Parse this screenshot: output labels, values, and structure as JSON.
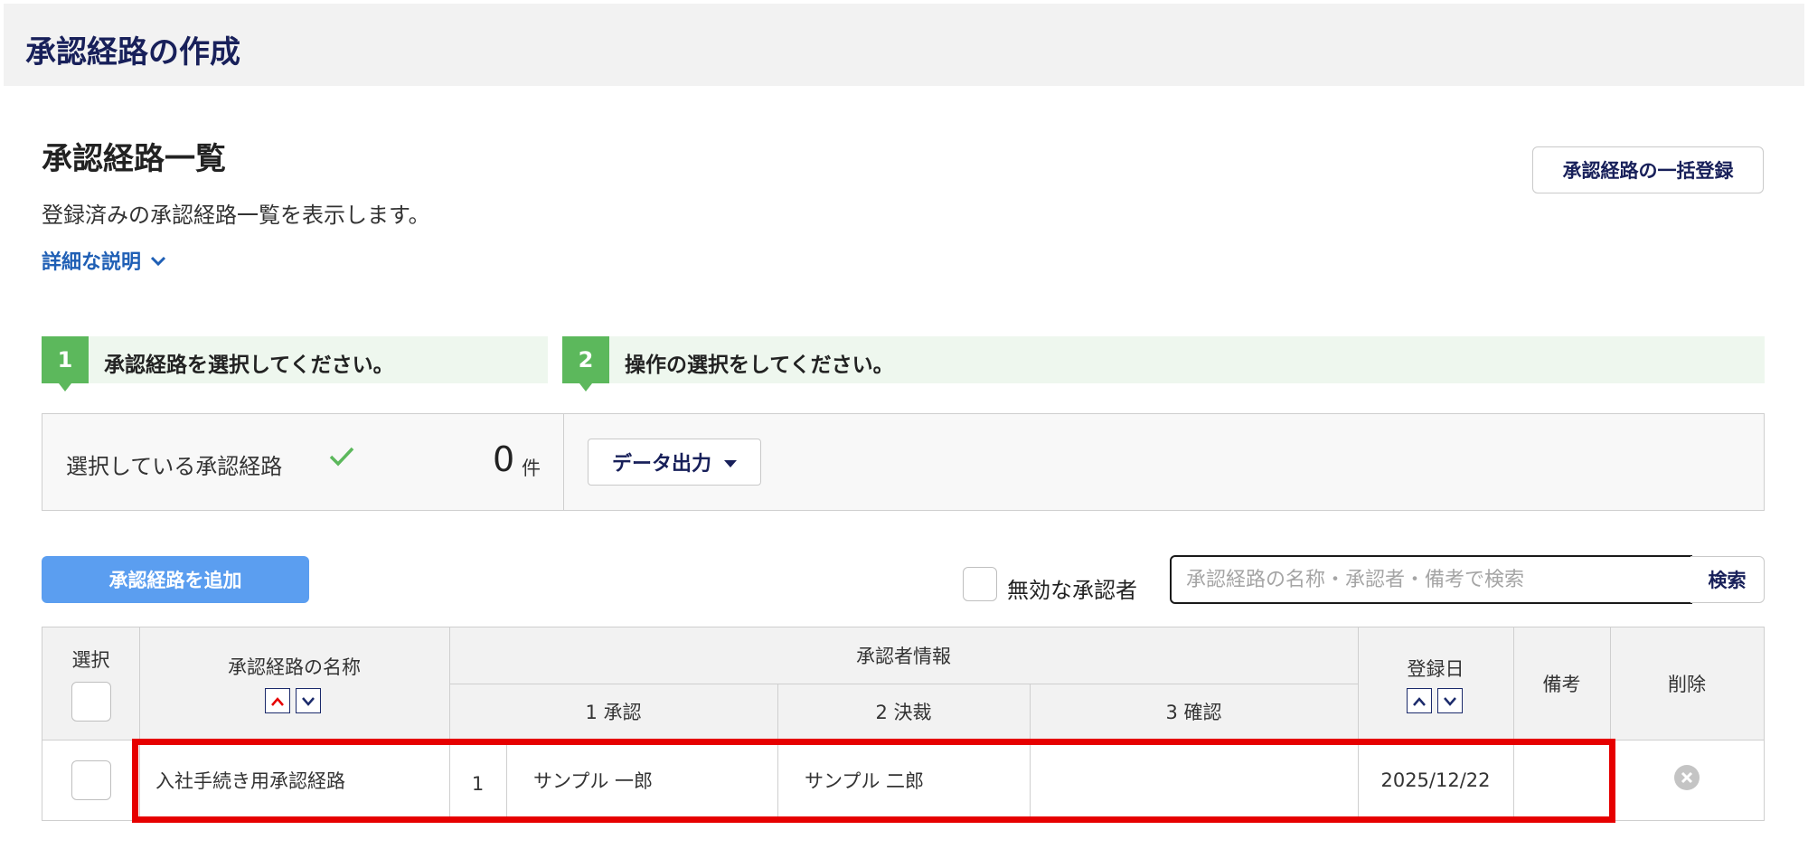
{
  "page": {
    "title": "承認経路の作成"
  },
  "section": {
    "title": "承認経路一覧",
    "description": "登録済みの承認経路一覧を表示します。",
    "details_link": "詳細な説明",
    "bulk_register_label": "承認経路の一括登録"
  },
  "steps": [
    {
      "number": "1",
      "text": "承認経路を選択してください。"
    },
    {
      "number": "2",
      "text": "操作の選択をしてください。"
    }
  ],
  "selection": {
    "label": "選択している承認経路",
    "count": "0",
    "unit": "件",
    "check_icon": "check-icon"
  },
  "export": {
    "label": "データ出力"
  },
  "toolbar": {
    "add_label": "承認経路を追加",
    "inactive_label": "無効な承認者",
    "search_placeholder": "承認経路の名称・承認者・備考で検索",
    "search_label": "検索"
  },
  "table": {
    "headers": {
      "select": "選択",
      "name": "承認経路の名称",
      "approver_info": "承認者情報",
      "step1": "1 承認",
      "step2": "2 決裁",
      "step3": "3 確認",
      "date": "登録日",
      "note": "備考",
      "delete": "削除"
    },
    "rows": [
      {
        "name": "入社手続き用承認経路",
        "index": "1",
        "approver1": "サンプル 一郎",
        "approver2": "サンプル 二郎",
        "approver3": "",
        "date": "2025/12/22",
        "note": ""
      }
    ]
  },
  "colors": {
    "brand_navy": "#18205a",
    "link_blue": "#1f5fb5",
    "step_green": "#5cb85c",
    "add_button": "#5b9ef0",
    "highlight_red": "#e60000"
  }
}
